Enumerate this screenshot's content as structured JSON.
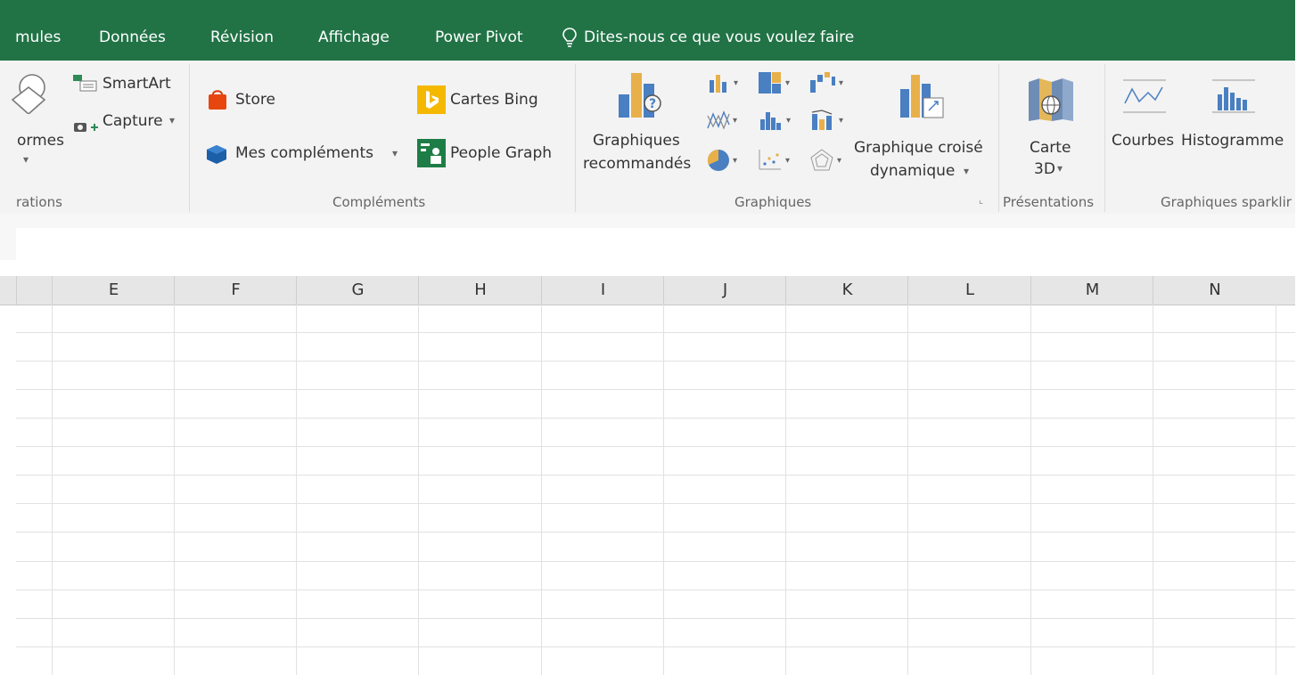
{
  "tabs": [
    "mules",
    "Données",
    "Révision",
    "Affichage",
    "Power Pivot"
  ],
  "tell_me": "Dites-nous ce que vous voulez faire",
  "ribbon": {
    "illustrations": {
      "formes": "ormes",
      "smartart": "SmartArt",
      "capture": "Capture",
      "group_label": "rations"
    },
    "complements": {
      "store": "Store",
      "mes_complements": "Mes compléments",
      "cartes_bing": "Cartes Bing",
      "people_graph": "People Graph",
      "group_label": "Compléments"
    },
    "graphiques": {
      "recommended_1": "Graphiques",
      "recommended_2": "recommandés",
      "pivot_1": "Graphique croisé",
      "pivot_2": "dynamique",
      "group_label": "Graphiques"
    },
    "presentations": {
      "carte": "Carte",
      "carte_3d": "3D",
      "group_label": "Présentations"
    },
    "sparklines": {
      "courbes": "Courbes",
      "histogramme": "Histogramme",
      "group_label": "Graphiques sparklir"
    }
  },
  "columns": [
    "E",
    "F",
    "G",
    "H",
    "I",
    "J",
    "K",
    "L",
    "M",
    "N"
  ],
  "colors": {
    "accent": "#217346"
  }
}
